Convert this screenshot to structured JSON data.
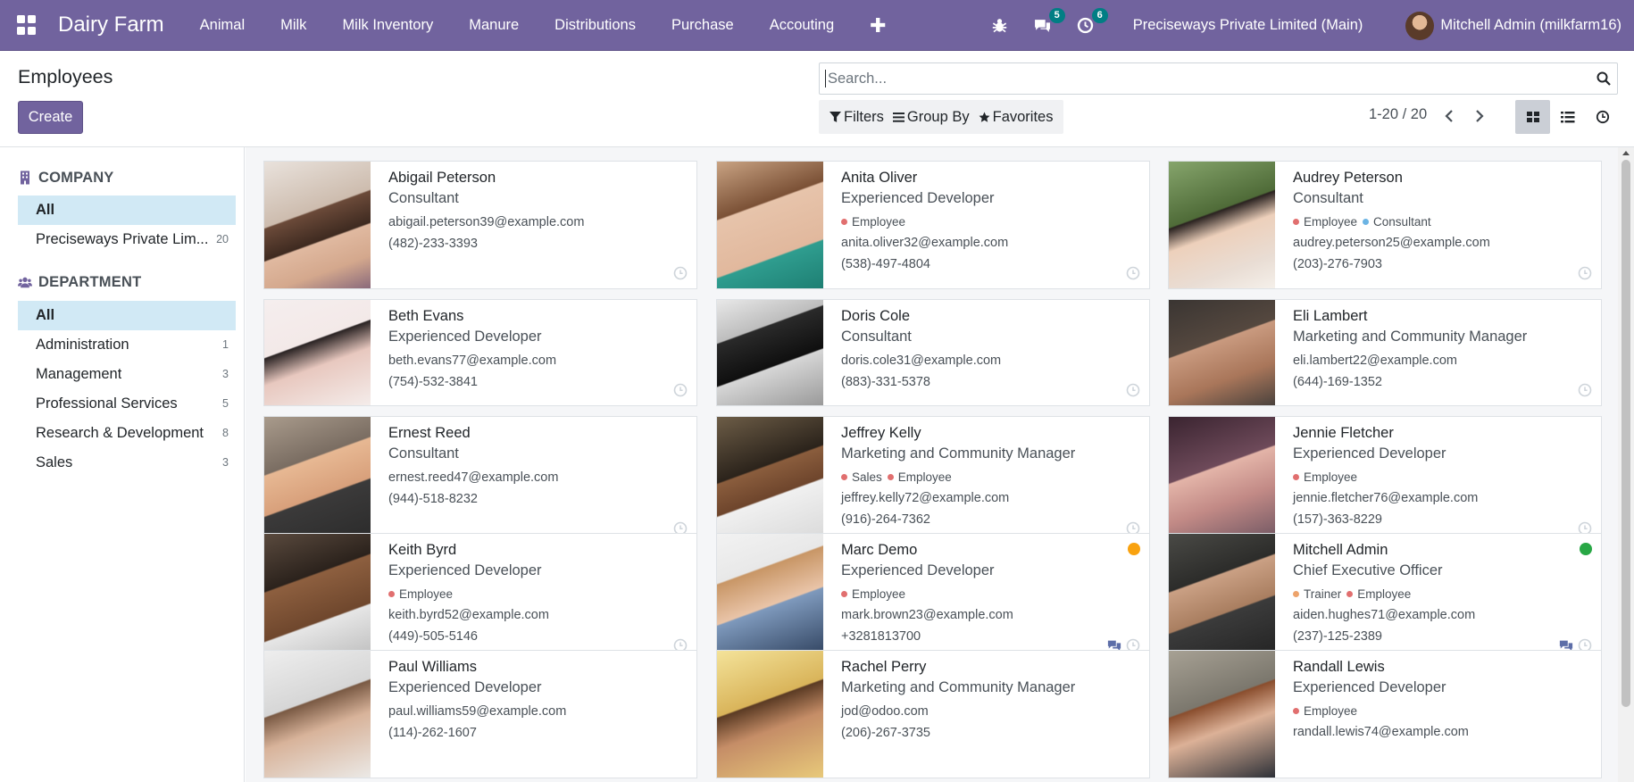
{
  "app": {
    "brand": "Dairy Farm",
    "menu": [
      "Animal",
      "Milk",
      "Milk Inventory",
      "Manure",
      "Distributions",
      "Purchase",
      "Accouting"
    ],
    "plus_label": "✚",
    "chat_count": "5",
    "activity_count": "6",
    "company": "Preciseways Private Limited (Main)",
    "user": "Mitchell Admin (milkfarm16)"
  },
  "control": {
    "title": "Employees",
    "create_label": "Create",
    "search_placeholder": "Search...",
    "filters_label": "Filters",
    "groupby_label": "Group By",
    "favorites_label": "Favorites",
    "pager": "1-20 / 20"
  },
  "sidebar": {
    "company_header": "COMPANY",
    "company_items": [
      {
        "label": "All",
        "count": ""
      },
      {
        "label": "Preciseways Private Lim...",
        "count": "20"
      }
    ],
    "department_header": "DEPARTMENT",
    "department_items": [
      {
        "label": "All",
        "count": ""
      },
      {
        "label": "Administration",
        "count": "1"
      },
      {
        "label": "Management",
        "count": "3"
      },
      {
        "label": "Professional Services",
        "count": "5"
      },
      {
        "label": "Research & Development",
        "count": "8"
      },
      {
        "label": "Sales",
        "count": "3"
      }
    ]
  },
  "colors": {
    "navbar": "#71639e",
    "active_filter": "#d1e9f5",
    "tag_red": "#e16f6f",
    "tag_blue": "#6cb4e4",
    "tag_orange": "#eda36b",
    "presence_away": "#f9a20f",
    "presence_online": "#28a745"
  },
  "employees": [
    {
      "name": "Abigail Peterson",
      "job": "Consultant",
      "tags": [],
      "email": "abigail.peterson39@example.com",
      "phone": "(482)-233-3393",
      "presence": "",
      "chat": false
    },
    {
      "name": "Anita Oliver",
      "job": "Experienced Developer",
      "tags": [
        {
          "label": "Employee",
          "color": "#e16f6f"
        }
      ],
      "email": "anita.oliver32@example.com",
      "phone": "(538)-497-4804",
      "presence": "",
      "chat": false
    },
    {
      "name": "Audrey Peterson",
      "job": "Consultant",
      "tags": [
        {
          "label": "Employee",
          "color": "#e16f6f"
        },
        {
          "label": "Consultant",
          "color": "#6cb4e4"
        }
      ],
      "email": "audrey.peterson25@example.com",
      "phone": "(203)-276-7903",
      "presence": "",
      "chat": false
    },
    {
      "name": "Beth Evans",
      "job": "Experienced Developer",
      "tags": [],
      "email": "beth.evans77@example.com",
      "phone": "(754)-532-3841",
      "presence": "",
      "chat": false
    },
    {
      "name": "Doris Cole",
      "job": "Consultant",
      "tags": [],
      "email": "doris.cole31@example.com",
      "phone": "(883)-331-5378",
      "presence": "",
      "chat": false
    },
    {
      "name": "Eli Lambert",
      "job": "Marketing and Community Manager",
      "tags": [],
      "email": "eli.lambert22@example.com",
      "phone": "(644)-169-1352",
      "presence": "",
      "chat": false
    },
    {
      "name": "Ernest Reed",
      "job": "Consultant",
      "tags": [],
      "email": "ernest.reed47@example.com",
      "phone": "(944)-518-8232",
      "presence": "",
      "chat": false
    },
    {
      "name": "Jeffrey Kelly",
      "job": "Marketing and Community Manager",
      "tags": [
        {
          "label": "Sales",
          "color": "#e16f6f"
        },
        {
          "label": "Employee",
          "color": "#e16f6f"
        }
      ],
      "email": "jeffrey.kelly72@example.com",
      "phone": "(916)-264-7362",
      "presence": "",
      "chat": false
    },
    {
      "name": "Jennie Fletcher",
      "job": "Experienced Developer",
      "tags": [
        {
          "label": "Employee",
          "color": "#e16f6f"
        }
      ],
      "email": "jennie.fletcher76@example.com",
      "phone": "(157)-363-8229",
      "presence": "",
      "chat": false
    },
    {
      "name": "Keith Byrd",
      "job": "Experienced Developer",
      "tags": [
        {
          "label": "Employee",
          "color": "#e16f6f"
        }
      ],
      "email": "keith.byrd52@example.com",
      "phone": "(449)-505-5146",
      "presence": "",
      "chat": false
    },
    {
      "name": "Marc Demo",
      "job": "Experienced Developer",
      "tags": [
        {
          "label": "Employee",
          "color": "#e16f6f"
        }
      ],
      "email": "mark.brown23@example.com",
      "phone": "+3281813700",
      "presence": "#f9a20f",
      "chat": true
    },
    {
      "name": "Mitchell Admin",
      "job": "Chief Executive Officer",
      "tags": [
        {
          "label": "Trainer",
          "color": "#eda36b"
        },
        {
          "label": "Employee",
          "color": "#e16f6f"
        }
      ],
      "email": "aiden.hughes71@example.com",
      "phone": "(237)-125-2389",
      "presence": "#28a745",
      "chat": true
    },
    {
      "name": "Paul Williams",
      "job": "Experienced Developer",
      "tags": [],
      "email": "paul.williams59@example.com",
      "phone": "(114)-262-1607",
      "presence": "",
      "chat": false
    },
    {
      "name": "Rachel Perry",
      "job": "Marketing and Community Manager",
      "tags": [],
      "email": "jod@odoo.com",
      "phone": "(206)-267-3735",
      "presence": "",
      "chat": false
    },
    {
      "name": "Randall Lewis",
      "job": "Experienced Developer",
      "tags": [
        {
          "label": "Employee",
          "color": "#e16f6f"
        }
      ],
      "email": "randall.lewis74@example.com",
      "phone": "",
      "presence": "",
      "chat": false
    }
  ]
}
